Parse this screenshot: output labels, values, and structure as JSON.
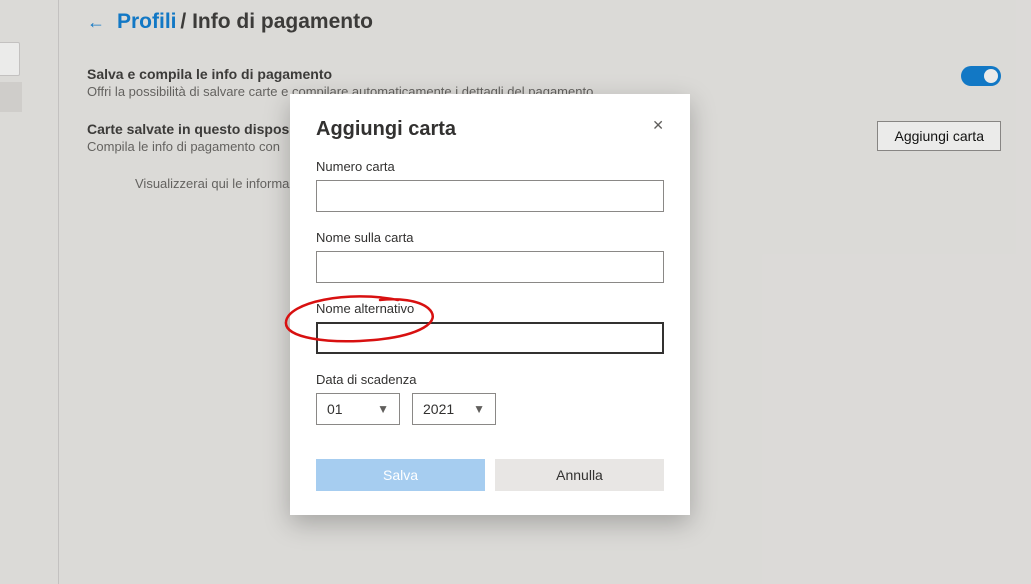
{
  "breadcrumb": {
    "link": "Profili",
    "current": "Info di pagamento"
  },
  "settings": {
    "save_fill": {
      "title": "Salva e compila le info di pagamento",
      "desc": "Offri la possibilità di salvare carte e compilare automaticamente i dettagli del pagamento",
      "toggle_on": true
    },
    "saved_cards": {
      "title": "Carte salvate in questo dispositivo",
      "desc": "Compila le info di pagamento con",
      "button": "Aggiungi carta",
      "empty": "Visualizzerai qui le informazioni"
    }
  },
  "modal": {
    "title": "Aggiungi carta",
    "fields": {
      "card_number": {
        "label": "Numero carta",
        "value": ""
      },
      "name_on_card": {
        "label": "Nome sulla carta",
        "value": ""
      },
      "nickname": {
        "label": "Nome alternativo",
        "value": ""
      },
      "expiry": {
        "label": "Data di scadenza",
        "month": "01",
        "year": "2021"
      }
    },
    "actions": {
      "save": "Salva",
      "cancel": "Annulla"
    }
  }
}
